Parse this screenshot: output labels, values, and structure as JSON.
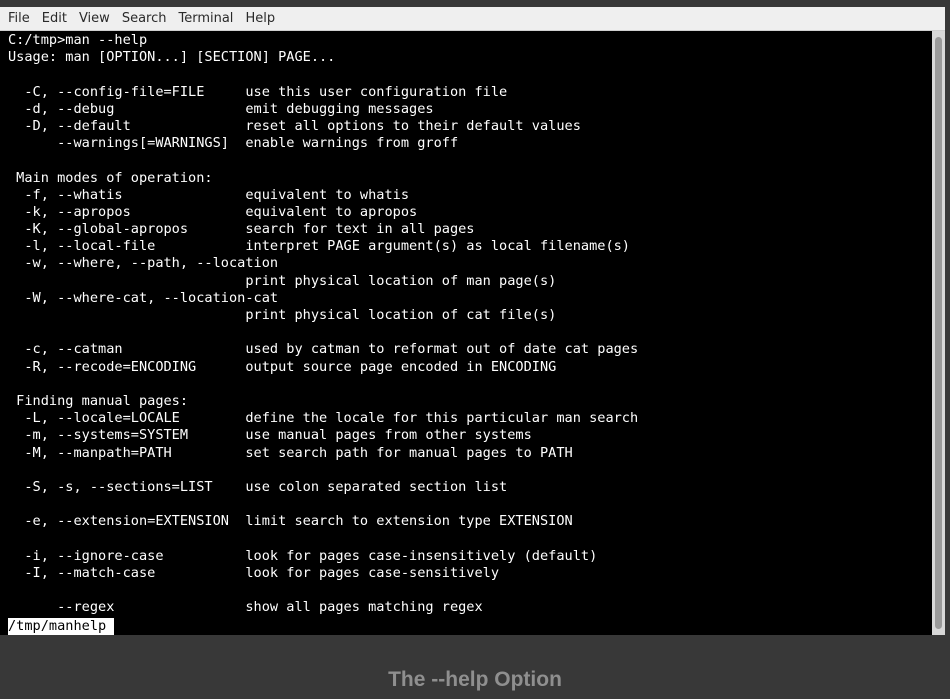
{
  "menubar": {
    "items": [
      "File",
      "Edit",
      "View",
      "Search",
      "Terminal",
      "Help"
    ]
  },
  "terminal": {
    "lines": [
      "C:/tmp>man --help",
      "Usage: man [OPTION...] [SECTION] PAGE...",
      "",
      "  -C, --config-file=FILE     use this user configuration file",
      "  -d, --debug                emit debugging messages",
      "  -D, --default              reset all options to their default values",
      "      --warnings[=WARNINGS]  enable warnings from groff",
      "",
      " Main modes of operation:",
      "  -f, --whatis               equivalent to whatis",
      "  -k, --apropos              equivalent to apropos",
      "  -K, --global-apropos       search for text in all pages",
      "  -l, --local-file           interpret PAGE argument(s) as local filename(s)",
      "  -w, --where, --path, --location",
      "                             print physical location of man page(s)",
      "  -W, --where-cat, --location-cat",
      "                             print physical location of cat file(s)",
      "",
      "  -c, --catman               used by catman to reformat out of date cat pages",
      "  -R, --recode=ENCODING      output source page encoded in ENCODING",
      "",
      " Finding manual pages:",
      "  -L, --locale=LOCALE        define the locale for this particular man search",
      "  -m, --systems=SYSTEM       use manual pages from other systems",
      "  -M, --manpath=PATH         set search path for manual pages to PATH",
      "",
      "  -S, -s, --sections=LIST    use colon separated section list",
      "",
      "  -e, --extension=EXTENSION  limit search to extension type EXTENSION",
      "",
      "  -i, --ignore-case          look for pages case-insensitively (default)",
      "  -I, --match-case           look for pages case-sensitively",
      "",
      "      --regex                show all pages matching regex"
    ],
    "bottom_prompt": "/tmp/manhelp"
  },
  "caption": "The --help Option",
  "colors": {
    "terminal_bg": "#000000",
    "terminal_fg": "#ffffff",
    "menubar_bg": "#efefef",
    "page_bg": "#383838",
    "caption": "#8f8f8f"
  }
}
